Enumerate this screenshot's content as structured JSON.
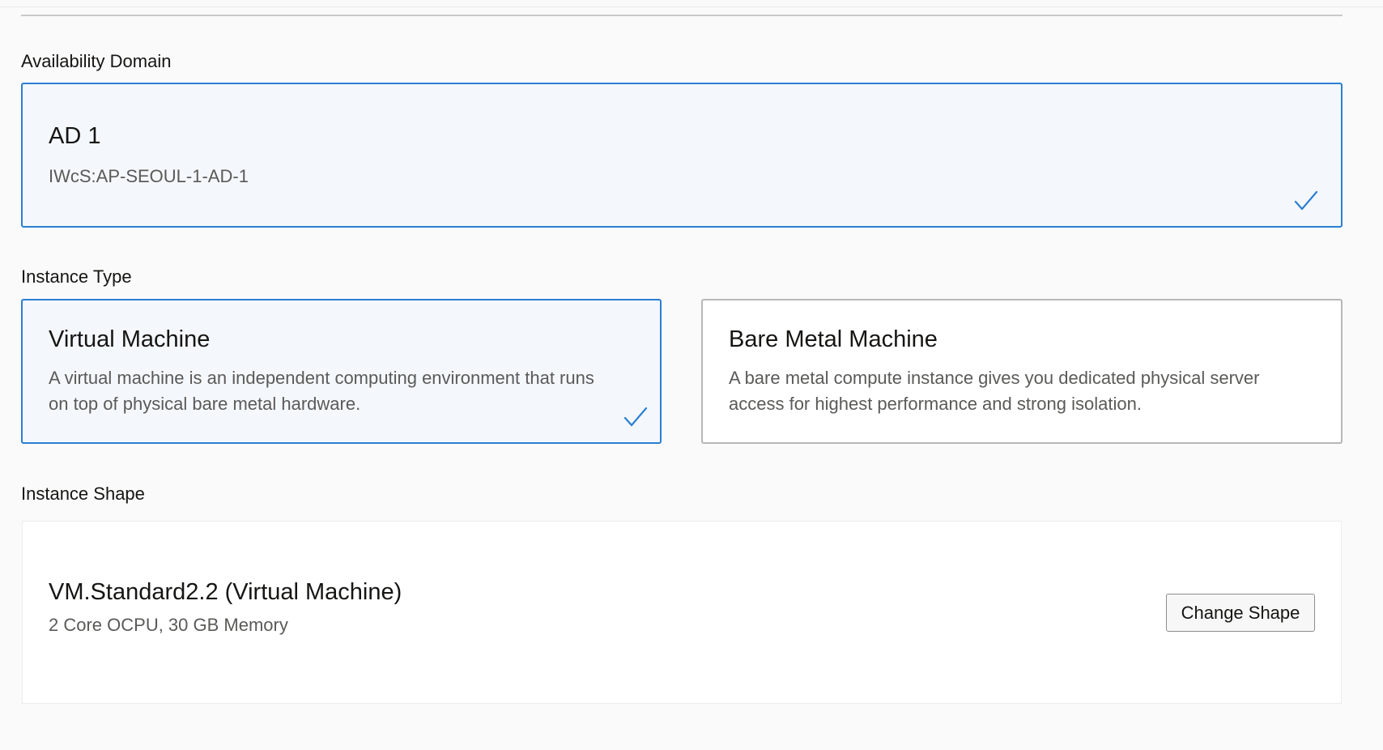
{
  "availability_domain": {
    "label": "Availability Domain",
    "option": {
      "title": "AD 1",
      "subtitle": "IWcS:AP-SEOUL-1-AD-1",
      "selected": true
    }
  },
  "instance_type": {
    "label": "Instance Type",
    "options": [
      {
        "title": "Virtual Machine",
        "description_line1": "A virtual machine is an independent computing environment that runs",
        "description_line2": "on top of physical bare metal hardware.",
        "selected": true
      },
      {
        "title": "Bare Metal Machine",
        "description_line1": "A bare metal compute instance gives you dedicated physical server",
        "description_line2": "access for highest performance and strong isolation.",
        "selected": false
      }
    ]
  },
  "instance_shape": {
    "label": "Instance Shape",
    "name": "VM.Standard2.2 (Virtual Machine)",
    "details": "2 Core OCPU, 30 GB Memory",
    "change_button_label": "Change Shape"
  },
  "icons": {
    "selected_check": "checkmark-icon"
  },
  "colors": {
    "accent": "#2b7fd2",
    "selected_bg": "#f4f8fc",
    "unselected_border": "#b7b7b7",
    "text_primary": "#161513",
    "text_secondary": "#5a5a58"
  }
}
